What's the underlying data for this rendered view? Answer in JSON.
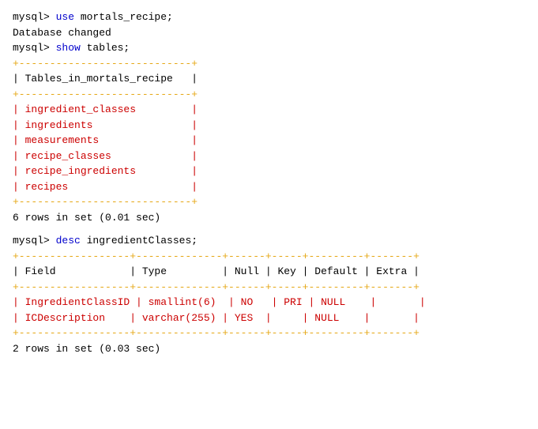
{
  "terminal": {
    "lines": [
      {
        "type": "prompt",
        "text": "mysql> use mortals_recipe;"
      },
      {
        "type": "plain",
        "text": "Database changed"
      },
      {
        "type": "prompt",
        "text": "mysql> show tables;"
      },
      {
        "type": "border",
        "text": "+----------------------------+"
      },
      {
        "type": "header",
        "text": "| Tables_in_mortals_recipe   |"
      },
      {
        "type": "border",
        "text": "+----------------------------+"
      },
      {
        "type": "value",
        "text": "| ingredient_classes         |"
      },
      {
        "type": "value",
        "text": "| ingredients                |"
      },
      {
        "type": "value",
        "text": "| measurements               |"
      },
      {
        "type": "value",
        "text": "| recipe_classes             |"
      },
      {
        "type": "value",
        "text": "| recipe_ingredients         |"
      },
      {
        "type": "value",
        "text": "| recipes                    |"
      },
      {
        "type": "border",
        "text": "+----------------------------+"
      },
      {
        "type": "result",
        "text": "6 rows in set (0.01 sec)"
      },
      {
        "type": "spacer"
      },
      {
        "type": "prompt",
        "text": "mysql> desc ingredientClasses;"
      },
      {
        "type": "border2",
        "text": "+------------------+--------------+------+-----+---------+-------+"
      },
      {
        "type": "header2",
        "text": "| Field            | Type         | Null | Key | Default | Extra |"
      },
      {
        "type": "border2",
        "text": "+------------------+--------------+------+-----+---------+-------+"
      },
      {
        "type": "value2",
        "text": "| IngredientClassID | smallint(6)  | NO   | PRI | NULL    |       |"
      },
      {
        "type": "value2",
        "text": "| ICDescription    | varchar(255) | YES  |     | NULL    |       |"
      },
      {
        "type": "border2",
        "text": "+------------------+--------------+------+-----+---------+-------+"
      },
      {
        "type": "result",
        "text": "2 rows in set (0.03 sec)"
      }
    ]
  }
}
